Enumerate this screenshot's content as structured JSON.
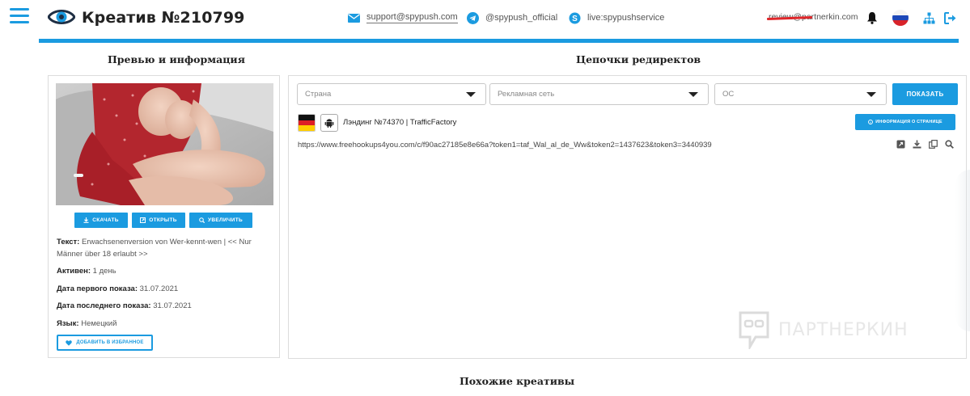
{
  "header": {
    "title": "Креатив №210799",
    "contacts": {
      "email": "support@spypush.com",
      "telegram": "@spypush_official",
      "skype": "live:spypushservice"
    },
    "user_email": "review@partnerkin.com"
  },
  "sections": {
    "preview_title": "Превью и информация",
    "redirects_title": "Цепочки редиректов",
    "similar_title": "Похожие креативы"
  },
  "preview": {
    "buttons": {
      "download": "скачать",
      "open": "открыть",
      "enlarge": "увеличить"
    },
    "info": {
      "text_label": "Текст:",
      "text_value": "Erwachsenenversion von Wer-kennt-wen | << Nur Männer über 18 erlaubt >>",
      "active_label": "Активен:",
      "active_value": "1 день",
      "first_label": "Дата первого показа:",
      "first_value": "31.07.2021",
      "last_label": "Дата последнего показа:",
      "last_value": "31.07.2021",
      "lang_label": "Язык:",
      "lang_value": "Немецкий"
    },
    "favorite_button": "добавить в избранное"
  },
  "filters": {
    "country_placeholder": "Страна",
    "network_placeholder": "Рекламная сеть",
    "os_placeholder": "ОС",
    "show_button": "ПОКАЗАТЬ"
  },
  "landing": {
    "title": "Лэндинг №74370 | TrafficFactory",
    "page_info_button": "ИНФОРМАЦИЯ О СТРАНИЦЕ",
    "url": "https://www.freehookups4you.com/c/f90ac27185e8e66a?token1=taf_Wal_al_de_Ww&token2=1437623&token3=3440939"
  },
  "watermark": "ПАРТНЕРКИН",
  "colors": {
    "accent": "#1b9be0",
    "strike": "#e0262a",
    "text": "#222222"
  }
}
